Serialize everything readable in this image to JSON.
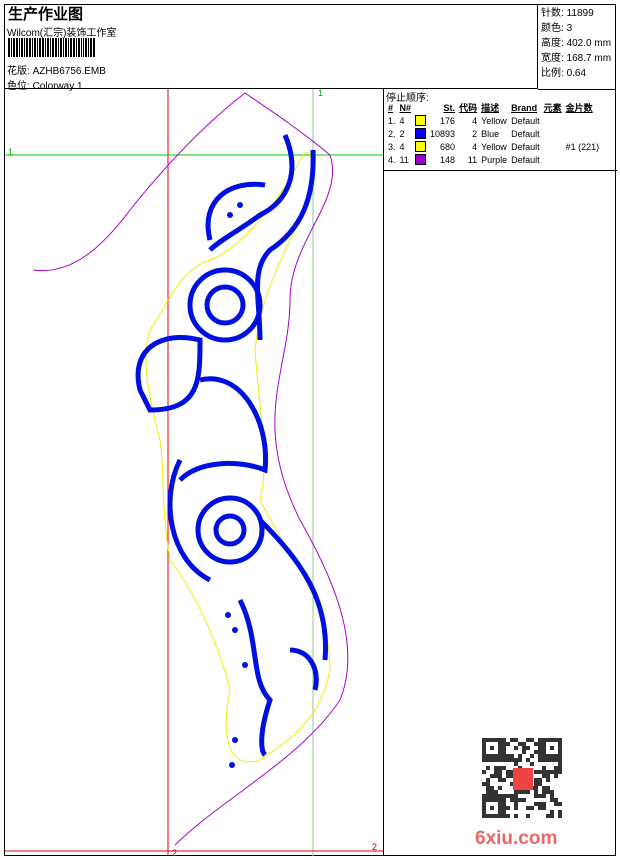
{
  "header": {
    "title": "生产作业图",
    "company": "Wilcom(汇宗)装饰工作室",
    "design_label": "花版:",
    "design_value": "AZHB6756.EMB",
    "colorway_label": "色位:",
    "colorway_value": "Colorway 1"
  },
  "stats": [
    {
      "label": "针数:",
      "value": "11899"
    },
    {
      "label": "颜色:",
      "value": "3"
    },
    {
      "label": "高度:",
      "value": "402.0 mm"
    },
    {
      "label": "宽度:",
      "value": "168.7 mm"
    },
    {
      "label": "比例:",
      "value": "0.64"
    }
  ],
  "stop_sequence": {
    "title": "停止顺序:",
    "columns": [
      "#",
      "N#",
      "",
      "St.",
      "代码",
      "描述",
      "Brand",
      "元素",
      "金片数"
    ],
    "rows": [
      {
        "idx": "1.",
        "n": "4",
        "color": "#ffff00",
        "st": "176",
        "code": "4",
        "desc": "Yellow",
        "brand": "Default",
        "elem": "",
        "seq": ""
      },
      {
        "idx": "2.",
        "n": "2",
        "color": "#0000ff",
        "st": "10893",
        "code": "2",
        "desc": "Blue",
        "brand": "Default",
        "elem": "",
        "seq": ""
      },
      {
        "idx": "3.",
        "n": "4",
        "color": "#ffff00",
        "st": "680",
        "code": "4",
        "desc": "Yellow",
        "brand": "Default",
        "elem": "",
        "seq": "#1 (221)"
      },
      {
        "idx": "4.",
        "n": "11",
        "color": "#9900cc",
        "st": "148",
        "code": "11",
        "desc": "Purple",
        "brand": "Default",
        "elem": "",
        "seq": ""
      }
    ]
  },
  "guides": {
    "top": "1",
    "left": "1",
    "bottom": "2",
    "right": "2"
  },
  "watermark": "6xiu.com"
}
